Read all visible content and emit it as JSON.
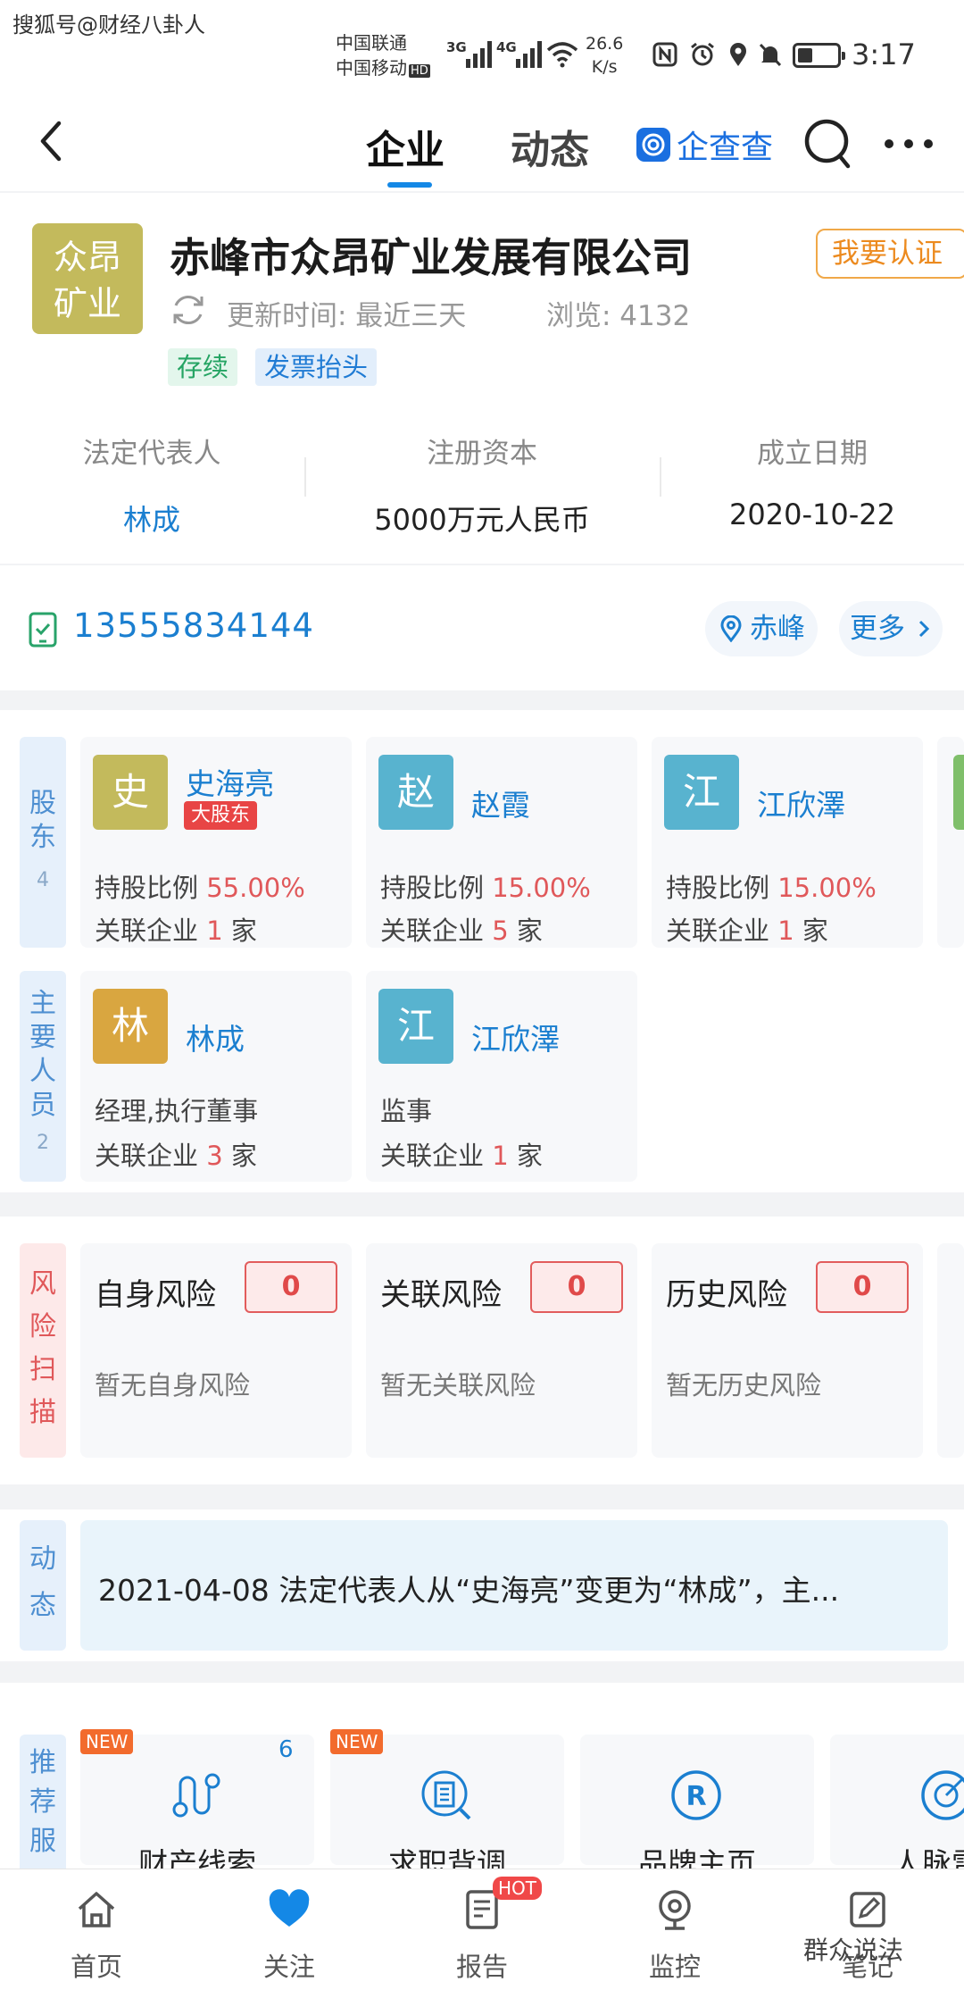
{
  "watermark_top": "搜狐号@财经八卦人",
  "status_bar": {
    "carrier_1": "中国联通",
    "carrier_2": "中国移动",
    "hd_badge": "HD",
    "net_1": "3G",
    "net_2": "4G",
    "speed_value": "26.6",
    "speed_unit": "K/s",
    "time": "3:17"
  },
  "nav": {
    "tabs": [
      {
        "label": "企业",
        "active": true
      },
      {
        "label": "动态",
        "active": false
      }
    ],
    "brand": "企查查",
    "accent": "#1488e6"
  },
  "company": {
    "logo_line1": "众昂",
    "logo_line2": "矿业",
    "name": "赤峰市众昂矿业发展有限公司",
    "verify_button": "我要认证",
    "update_label": "更新时间: 最近三天",
    "views_label": "浏览: 4132",
    "tags": [
      "存续",
      "发票抬头"
    ],
    "info": [
      {
        "label": "法定代表人",
        "value": "林成"
      },
      {
        "label": "注册资本",
        "value": "5000万元人民币"
      },
      {
        "label": "成立日期",
        "value": "2020-10-22"
      }
    ]
  },
  "contact": {
    "phone": "13555834144",
    "location": "赤峰",
    "more": "更多"
  },
  "shareholders": {
    "side_label": "股东",
    "count": "4",
    "items": [
      {
        "avatar": "史",
        "name": "史海亮",
        "badge": "大股东",
        "ratio_label": "持股比例",
        "ratio": "55.00%",
        "related_label": "关联企业",
        "related": "1",
        "unit": "家",
        "color": "#c3ba5c"
      },
      {
        "avatar": "赵",
        "name": "赵霞",
        "ratio_label": "持股比例",
        "ratio": "15.00%",
        "related_label": "关联企业",
        "related": "5",
        "unit": "家",
        "color": "#58b3cf"
      },
      {
        "avatar": "江",
        "name": "江欣澤",
        "ratio_label": "持股比例",
        "ratio": "15.00%",
        "related_label": "关联企业",
        "related": "1",
        "unit": "家",
        "color": "#58b3cf"
      }
    ]
  },
  "staff": {
    "side_label": "主要人员",
    "count": "2",
    "items": [
      {
        "avatar": "林",
        "name": "林成",
        "role": "经理,执行董事",
        "related_label": "关联企业",
        "related": "3",
        "unit": "家",
        "color": "#d9a640"
      },
      {
        "avatar": "江",
        "name": "江欣澤",
        "role": "监事",
        "related_label": "关联企业",
        "related": "1",
        "unit": "家",
        "color": "#58b3cf"
      }
    ]
  },
  "risk": {
    "side_label": "风险扫描",
    "items": [
      {
        "title": "自身风险",
        "count": "0",
        "desc": "暂无自身风险"
      },
      {
        "title": "关联风险",
        "count": "0",
        "desc": "暂无关联风险"
      },
      {
        "title": "历史风险",
        "count": "0",
        "desc": "暂无历史风险"
      }
    ]
  },
  "dynamics": {
    "side_label": "动态",
    "text": "2021-04-08 法定代表人从“史海亮”变更为“林成”，主..."
  },
  "services": {
    "side_label": "推荐服",
    "items": [
      {
        "name": "财产线索",
        "new": "NEW",
        "count": "6",
        "icon": "route-icon"
      },
      {
        "name": "求职背调",
        "new": "NEW",
        "icon": "building-search-icon"
      },
      {
        "name": "品牌主页",
        "icon": "registered-icon"
      },
      {
        "name": "人脉雷",
        "icon": "radar-icon"
      }
    ]
  },
  "tabbar": {
    "items": [
      {
        "label": "首页",
        "icon": "home-icon"
      },
      {
        "label": "关注",
        "icon": "heart-icon"
      },
      {
        "label": "报告",
        "icon": "report-icon",
        "hot": "HOT"
      },
      {
        "label": "监控",
        "icon": "monitor-icon"
      },
      {
        "label": "笔记",
        "icon": "note-icon"
      }
    ]
  },
  "watermark_bottom": "群众说法"
}
